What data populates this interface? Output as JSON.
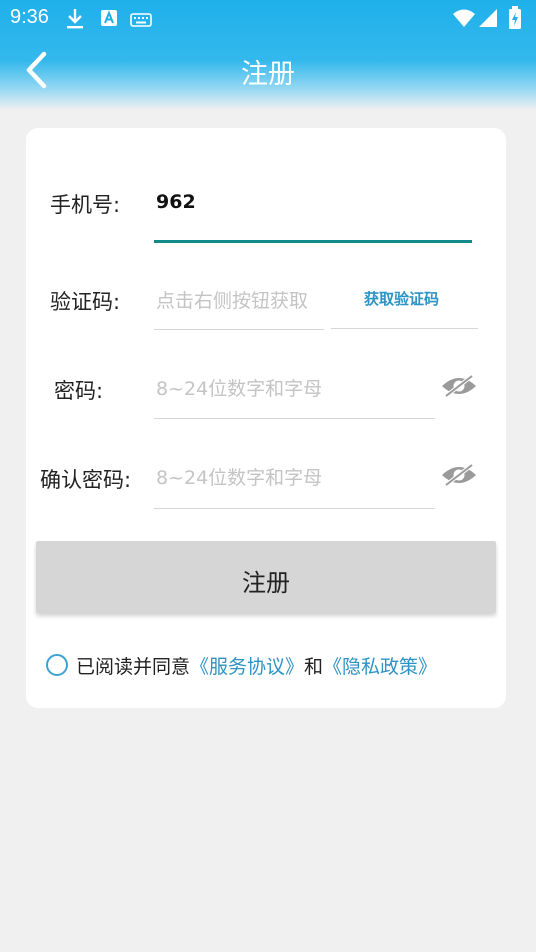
{
  "status_bar": {
    "time": "9:36"
  },
  "nav": {
    "title": "注册"
  },
  "form": {
    "phone": {
      "label": "手机号:",
      "value": "962"
    },
    "code": {
      "label": "验证码:",
      "placeholder": "点击右侧按钮获取",
      "button_label": "获取验证码"
    },
    "password": {
      "label": "密码:",
      "placeholder": "8~24位数字和字母"
    },
    "confirm_password": {
      "label": "确认密码:",
      "placeholder": "8~24位数字和字母"
    },
    "submit_label": "注册"
  },
  "agreement": {
    "prefix": "已阅读并同意",
    "service_link": "《服务协议》",
    "and": "和",
    "privacy_link": "《隐私政策》"
  },
  "colors": {
    "accent": "#1fb0ea",
    "input_focus": "#138a8a",
    "link": "#2d93c4"
  }
}
